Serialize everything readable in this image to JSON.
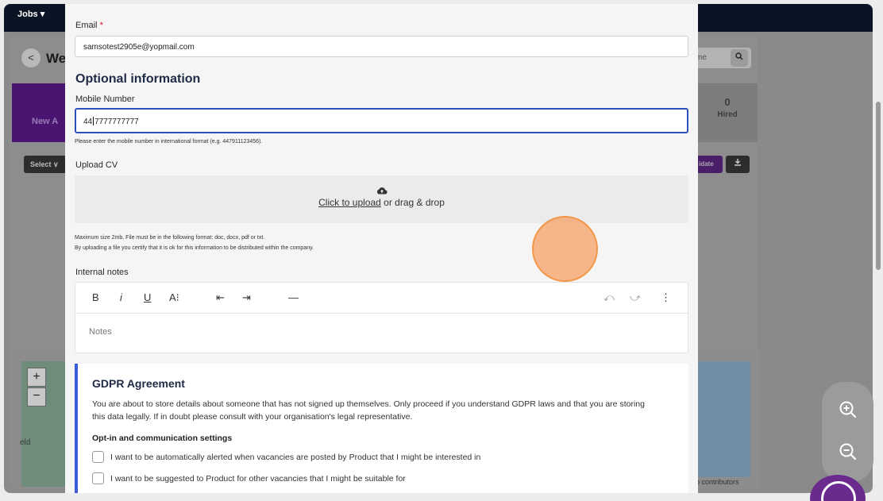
{
  "background": {
    "jobs_menu": "Jobs ▾",
    "page_title": "We",
    "search_placeholder": "me",
    "stage_new": "New A",
    "stage_hired_count": "0",
    "stage_hired_label": "Hired",
    "select_label": "Select ∨",
    "add_candidate_label": "idate",
    "map_town": "eld",
    "map_attribution": "p contributors"
  },
  "modal": {
    "email": {
      "label": "Email",
      "required_mark": "*",
      "value": "samsotest2905e@yopmail.com"
    },
    "optional_section_title": "Optional information",
    "mobile": {
      "label": "Mobile Number",
      "value_before_caret": "44",
      "value_after_caret": "7777777777",
      "help": "Please enter the mobile number in international format (e.g. 447911123456)."
    },
    "upload_cv": {
      "label": "Upload CV",
      "link_text": "Click to upload",
      "rest_text": " or drag & drop",
      "help_line1": "Maximum size 2mb. File must be in the following format: doc, docx, pdf or txt.",
      "help_line2": "By uploading a file you certify that it is ok for this information to be distributed within the company."
    },
    "internal_notes": {
      "label": "Internal notes",
      "placeholder": "Notes",
      "toolbar": {
        "bold": "B",
        "italic": "i",
        "underline": "U",
        "font_size": "A⁝",
        "outdent": "⇤",
        "indent": "⇥",
        "hr": "—",
        "undo": "⤺",
        "redo": "⤻",
        "more": "⋮"
      }
    },
    "gdpr": {
      "title": "GDPR Agreement",
      "body": "You are about to store details about someone that has not signed up themselves. Only proceed if you understand GDPR laws and that you are storing this data legally. If in doubt please consult with your organisation's legal representative.",
      "subtitle": "Opt-in and communication settings",
      "options": [
        "I want to be automatically alerted when vacancies are posted by Product that I might be interested in",
        "I want to be suggested to Product for other vacancies that I might be suitable for"
      ]
    }
  },
  "colors": {
    "accent": "#3c5bd6",
    "focus_border": "#2c4fbf",
    "required": "#dd1122",
    "cursor_highlight": "#f2974a"
  }
}
